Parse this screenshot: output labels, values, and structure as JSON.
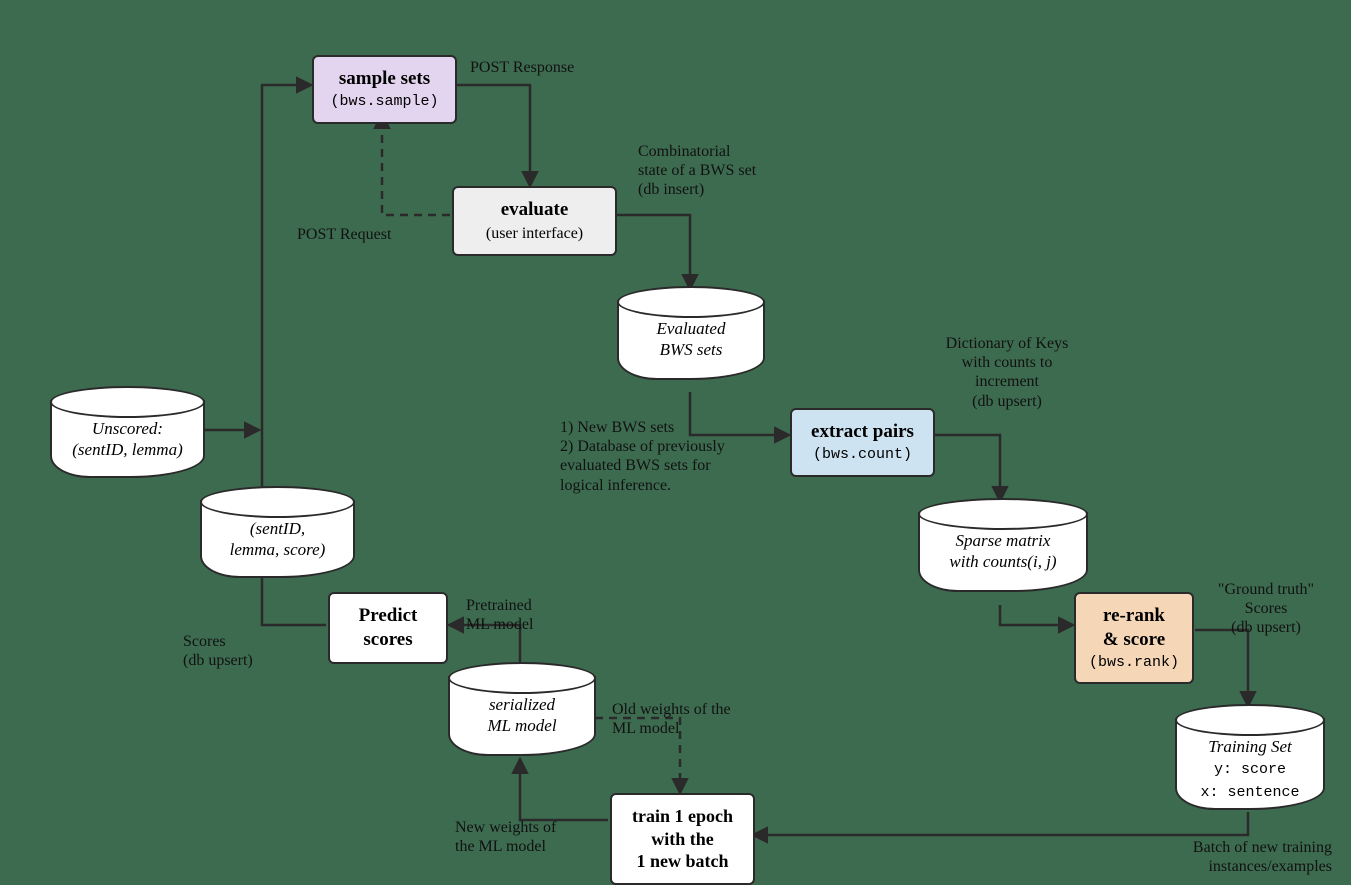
{
  "nodes": {
    "sample_sets": {
      "title": "sample sets",
      "sub": "(bws.sample)"
    },
    "evaluate": {
      "title": "evaluate",
      "sub": "(user interface)"
    },
    "extract": {
      "title": "extract pairs",
      "sub": "(bws.count)"
    },
    "rerank": {
      "title": "re-rank\n& score",
      "sub": "(bws.rank)"
    },
    "predict": {
      "title": "Predict\nscores"
    },
    "train": {
      "title": "train 1 epoch\nwith the\n1 new batch"
    }
  },
  "dbs": {
    "unscored": "Unscored:\n(sentID, lemma)",
    "scored": "(sentID,\nlemma, score)",
    "evalsets": "Evaluated\nBWS sets",
    "sparse": "Sparse matrix\nwith counts(i, j)",
    "training": {
      "title": "Training Set",
      "y": "y: score",
      "x": "x: sentence"
    },
    "serialized": "serialized\nML model"
  },
  "annotations": {
    "post_response": "POST Response",
    "post_request": "POST Request",
    "comb_state": "Combinatorial\nstate of a BWS set\n(db insert)",
    "eval_notes": "1) New BWS sets\n2) Database of previously\nevaluated BWS sets for\nlogical inference.",
    "dict_keys": "Dictionary of Keys\nwith counts to\nincrement\n(db upsert)",
    "ground_truth": "\"Ground truth\"\nScores\n(db upsert)",
    "batch_new": "Batch of new training\ninstances/examples",
    "new_weights": "New weights of\nthe ML model",
    "old_weights": "Old weights of the\nML model",
    "pretrained": "Pretrained\nML model",
    "scores_upsert": "Scores\n(db upsert)"
  }
}
